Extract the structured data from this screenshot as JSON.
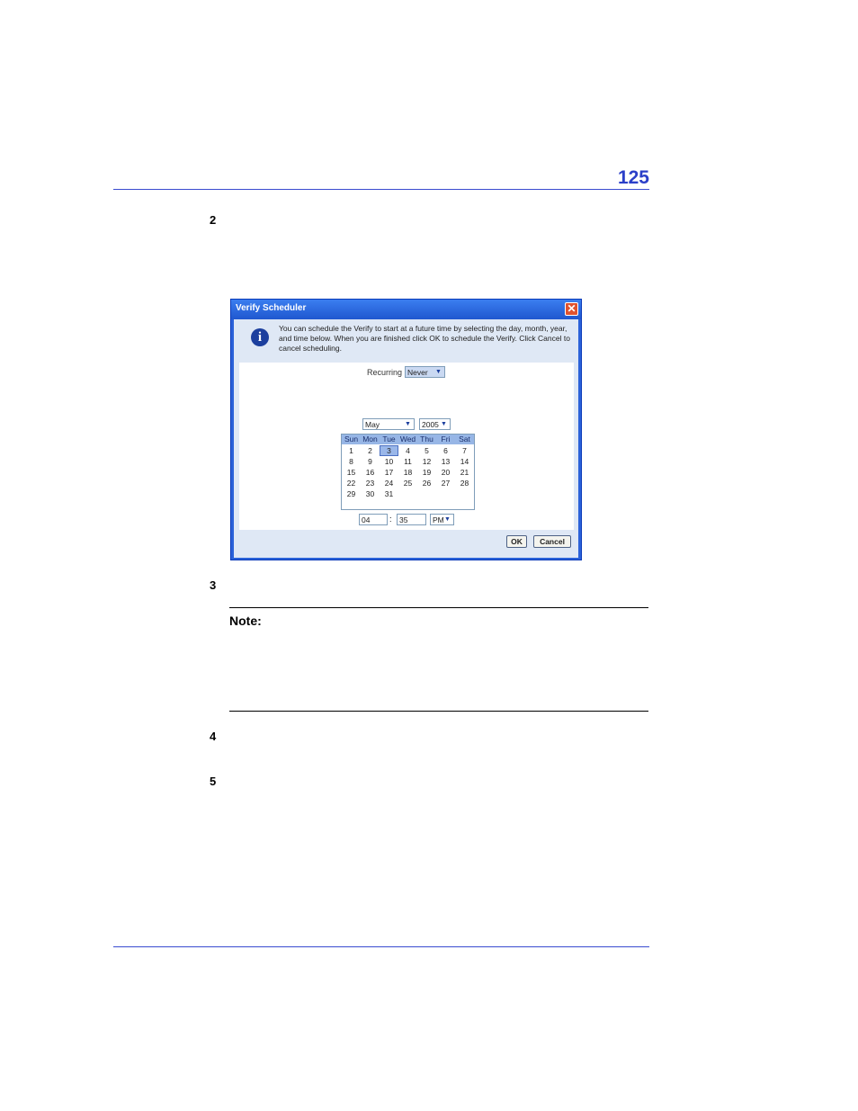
{
  "page": {
    "number": "125",
    "steps": [
      "2",
      "3",
      "4",
      "5"
    ],
    "note_label": "Note:"
  },
  "dialog": {
    "title": "Verify Scheduler",
    "close_glyph": "✕",
    "info_icon": "i",
    "info_text": "You can schedule the Verify to start at a future time by selecting the day, month, year, and time below. When you are finished click OK to schedule the Verify. Click Cancel to cancel scheduling.",
    "recurring_label": "Recurring",
    "recurring_value": "Never",
    "month_value": "May",
    "year_value": "2005",
    "weekdays": [
      "Sun",
      "Mon",
      "Tue",
      "Wed",
      "Thu",
      "Fri",
      "Sat"
    ],
    "weeks": [
      [
        "1",
        "2",
        "3",
        "4",
        "5",
        "6",
        "7"
      ],
      [
        "8",
        "9",
        "10",
        "11",
        "12",
        "13",
        "14"
      ],
      [
        "15",
        "16",
        "17",
        "18",
        "19",
        "20",
        "21"
      ],
      [
        "22",
        "23",
        "24",
        "25",
        "26",
        "27",
        "28"
      ],
      [
        "29",
        "30",
        "31",
        "",
        "",
        "",
        ""
      ]
    ],
    "selected_day": "3",
    "hour_value": "04",
    "colon": ":",
    "minute_value": "35",
    "ampm_value": "PM",
    "ok_label": "OK",
    "cancel_label": "Cancel"
  },
  "colors": {
    "heading_blue": "#2b3fc8",
    "titlebar_blue": "#2b62d9"
  }
}
